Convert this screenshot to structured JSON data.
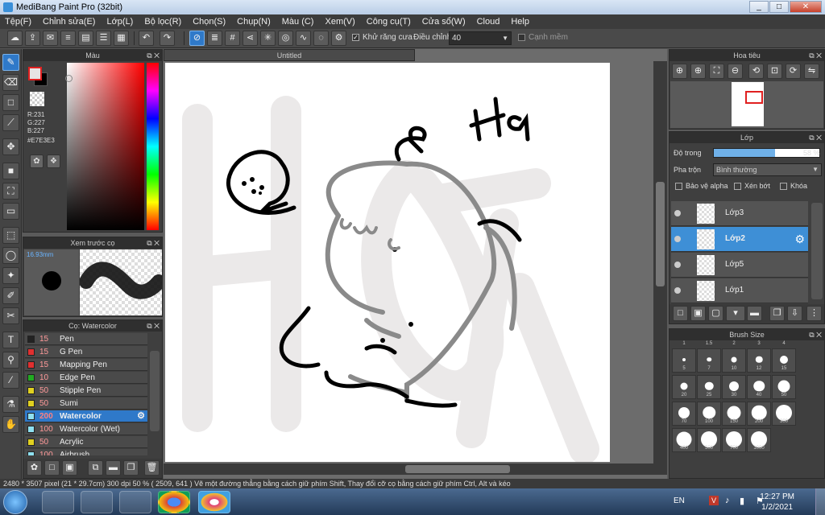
{
  "app": {
    "title": "MediBang Paint Pro (32bit)",
    "win_min": "_",
    "win_max": "□",
    "win_close": "✕"
  },
  "menu": [
    "Tệp(F)",
    "Chỉnh sửa(E)",
    "Lớp(L)",
    "Bộ lọc(R)",
    "Chọn(S)",
    "Chụp(N)",
    "Màu (C)",
    "Xem(V)",
    "Công cụ(T)",
    "Cửa sổ(W)",
    "Cloud",
    "Help"
  ],
  "toolbar": {
    "antialias_label": "Khử răng cưa",
    "adjust_label": "Điều chỉnh",
    "adjust_value": "40",
    "soft_edge_label": "Cạnh mềm"
  },
  "color_panel": {
    "title": "Màu",
    "r": "R:231",
    "g": "G:227",
    "b": "B:227",
    "hex": "#E7E3E3",
    "current_color": "#e7e3e3"
  },
  "brush_preview": {
    "title": "Xem trước cọ",
    "size": "16.93mm"
  },
  "brush_list": {
    "title": "Cọ: Watercolor",
    "items": [
      {
        "size": "15",
        "name": "Pen",
        "color": "#222222"
      },
      {
        "size": "15",
        "name": "G Pen",
        "color": "#e03030"
      },
      {
        "size": "15",
        "name": "Mapping Pen",
        "color": "#e03030"
      },
      {
        "size": "10",
        "name": "Edge Pen",
        "color": "#22aa22"
      },
      {
        "size": "50",
        "name": "Stipple Pen",
        "color": "#e0d020"
      },
      {
        "size": "50",
        "name": "Sumi",
        "color": "#e0d020"
      },
      {
        "size": "200",
        "name": "Watercolor",
        "color": "#8ee0f0"
      },
      {
        "size": "100",
        "name": "Watercolor (Wet)",
        "color": "#8ee0f0"
      },
      {
        "size": "50",
        "name": "Acrylic",
        "color": "#e0d020"
      },
      {
        "size": "100",
        "name": "Airbrush",
        "color": "#8ee0f0"
      }
    ]
  },
  "document": {
    "tab": "Untitled"
  },
  "navigator": {
    "title": "Hoa tiêu"
  },
  "layers": {
    "title": "Lớp",
    "opacity_label": "Độ trong",
    "opacity_value": "58 %",
    "opacity_level": 0.58,
    "blend_label": "Pha trộn",
    "blend_value": "Bình thường",
    "protect_alpha": "Bảo vệ alpha",
    "clipping": "Xén bớt",
    "lock": "Khóa",
    "items": [
      "Lớp3",
      "Lớp2",
      "Lớp5",
      "Lớp1"
    ]
  },
  "brush_size": {
    "title": "Brush Size",
    "header": [
      "1",
      "1.5",
      "2",
      "3",
      "4"
    ],
    "rows": [
      [
        "5",
        "7",
        "10",
        "12",
        "15"
      ],
      [
        "20",
        "25",
        "30",
        "40",
        "50"
      ],
      [
        "70",
        "100",
        "150",
        "200",
        "300"
      ],
      [
        "400",
        "500",
        "700",
        "1000"
      ]
    ]
  },
  "status": {
    "text": "2480 * 3507 pixel   (21 * 29.7cm)   300 dpi   50 %   ( 2509, 641 )   Vẽ một đường thẳng bằng cách giữ phím Shift, Thay đổi cỡ cọ bằng cách giữ phím Ctrl, Alt và kéo"
  },
  "taskbar": {
    "lang": "EN",
    "time": "12:27 PM",
    "date": "1/2/2021"
  },
  "canvas_text": {
    "handwriting": "Hà",
    "face": "owo"
  }
}
